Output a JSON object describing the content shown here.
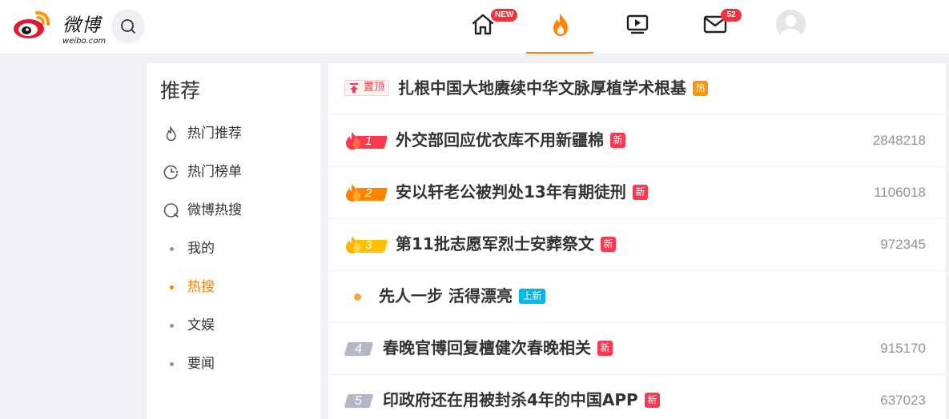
{
  "header": {
    "logo_text": "微博",
    "logo_sub": "weibo.com",
    "nav_home_badge": "NEW",
    "nav_msg_badge": "52"
  },
  "sidebar": {
    "title": "推荐",
    "items": [
      {
        "label": "热门推荐",
        "icon": "flame-outline-icon"
      },
      {
        "label": "热门榜单",
        "icon": "chart-clock-icon"
      },
      {
        "label": "微博热搜",
        "icon": "search-circle-icon"
      },
      {
        "label": "我的"
      },
      {
        "label": "热搜",
        "active": true
      },
      {
        "label": "文娱"
      },
      {
        "label": "要闻"
      }
    ]
  },
  "hot_list": {
    "pinned": {
      "pin_label": "置顶",
      "title": "扎根中国大地赓续中华文脉厚植学术根基",
      "tag": "热"
    },
    "items": [
      {
        "rank": "1",
        "title": "外交部回应优衣库不用新疆棉",
        "tag": "新",
        "count": "2848218"
      },
      {
        "rank": "2",
        "title": "安以轩老公被判处13年有期徒刑",
        "tag": "新",
        "count": "1106018"
      },
      {
        "rank": "3",
        "title": "第11批志愿军烈士安葬祭文",
        "tag": "新",
        "count": "972345"
      },
      {
        "rank": "",
        "title": "先人一步 活得漂亮",
        "tag": "上新",
        "count": ""
      },
      {
        "rank": "4",
        "title": "春晚官博回复檀健次春晚相关",
        "tag": "新",
        "count": "915170"
      },
      {
        "rank": "5",
        "title": "印政府还在用被封杀4年的中国APP",
        "tag": "新",
        "count": "637023"
      }
    ]
  },
  "colors": {
    "accent": "#ff8200",
    "new_tag": "#ff3852",
    "hot_tag": "#ff9406",
    "promo_tag": "#00b7ee",
    "rank_1": "#ff3852",
    "rank_2": "#ff8200",
    "rank_3": "#ffc000",
    "rank_default": "#b4b8c5"
  }
}
